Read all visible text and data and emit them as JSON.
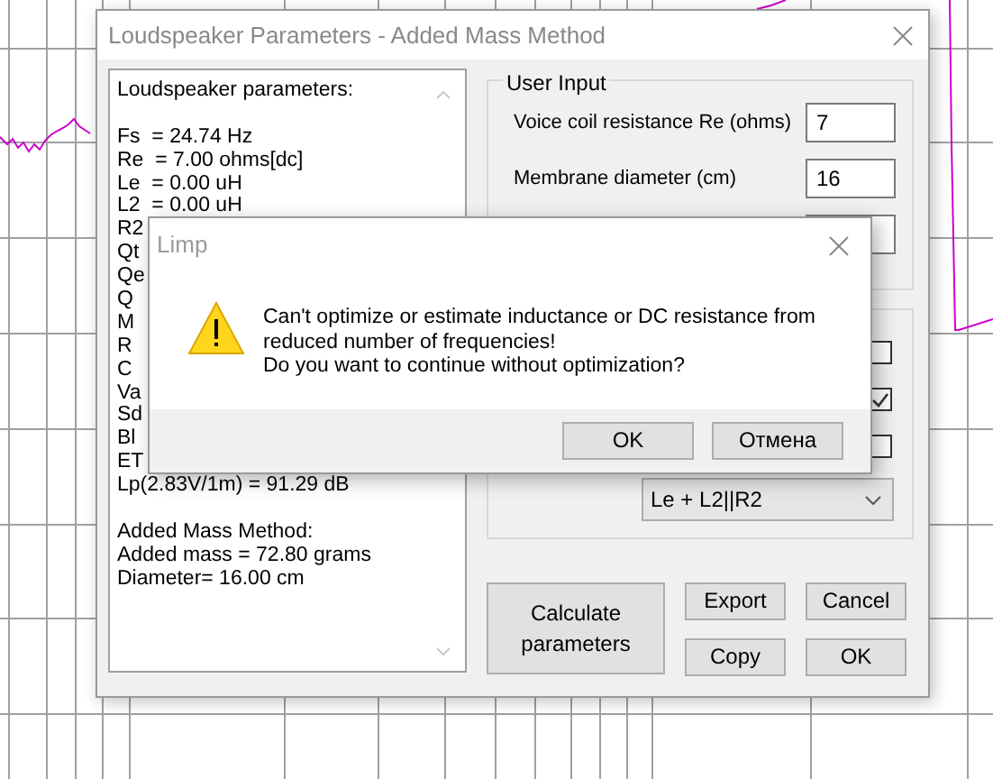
{
  "dialog": {
    "title": "Loudspeaker Parameters - Added Mass Method",
    "parameters_text": [
      [
        "Loudspeaker parameters:"
      ],
      [
        "Fs  = 24.74 Hz",
        "Re  = 7.00 ohms[dc]",
        "Le  = 0.00 uH",
        "L2  = 0.00 uH",
        "R2",
        "Qt",
        "Qe",
        "Q",
        "M",
        "R",
        "C",
        "Va",
        "Sd",
        "Bl",
        "ET",
        "Lp(2.83V/1m) = 91.29 dB"
      ],
      [
        "Added Mass Method:",
        "Added mass = 72.80 grams",
        "Diameter= 16.00 cm"
      ]
    ],
    "user_input": {
      "title": "User Input",
      "fields": [
        {
          "label": "Voice coil resistance Re (ohms)",
          "value": "7"
        },
        {
          "label": "Membrane diameter (cm)",
          "value": "16"
        }
      ]
    },
    "checkboxes": [
      {
        "checked": false
      },
      {
        "checked": true
      },
      {
        "checked": false
      }
    ],
    "model_select": {
      "value": "Le + L2||R2"
    },
    "buttons": [
      "Calculate parameters",
      "Export",
      "Cancel",
      "Copy",
      "OK"
    ]
  },
  "message_box": {
    "title": "Limp",
    "message": "Can't optimize or estimate inductance or DC resistance from\nreduced number of frequencies!\nDo you want to continue without optimization?",
    "buttons": [
      "OK",
      "Отмена"
    ]
  }
}
